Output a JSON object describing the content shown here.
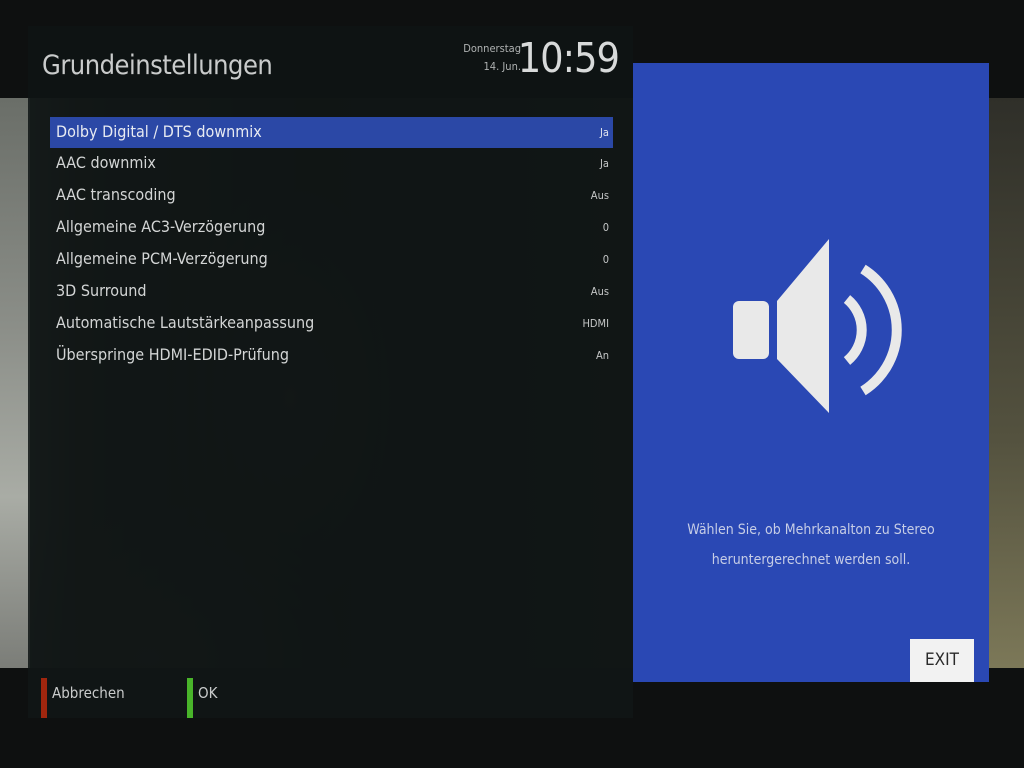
{
  "menu": {
    "title": "Grundeinstellungen",
    "clock": {
      "day": "Donnerstag",
      "date": "14. Jun.",
      "time": "10:59"
    },
    "items": [
      {
        "label": "Dolby Digital / DTS downmix",
        "value": "Ja",
        "selected": true
      },
      {
        "label": "AAC downmix",
        "value": "Ja",
        "selected": false
      },
      {
        "label": "AAC transcoding",
        "value": "Aus",
        "selected": false
      },
      {
        "label": "Allgemeine AC3-Verzögerung",
        "value": "0",
        "selected": false
      },
      {
        "label": "Allgemeine PCM-Verzögerung",
        "value": "0",
        "selected": false
      },
      {
        "label": "3D Surround",
        "value": "Aus",
        "selected": false
      },
      {
        "label": "Automatische Lautstärkeanpassung",
        "value": "HDMI",
        "selected": false
      },
      {
        "label": "Überspringe HDMI-EDID-Prüfung",
        "value": "An",
        "selected": false
      }
    ]
  },
  "help": {
    "icon": "speaker-volume-icon",
    "line1": "Wählen Sie, ob Mehrkanalton zu Stereo",
    "line2": "heruntergerechnet werden soll.",
    "exit_label": "EXIT"
  },
  "footer": {
    "cancel_label": "Abbrechen",
    "ok_label": "OK"
  },
  "colors": {
    "selection": "#2b48a6",
    "help_panel": "#2a48b4",
    "red_key": "#a0260e",
    "green_key": "#49b42a"
  }
}
